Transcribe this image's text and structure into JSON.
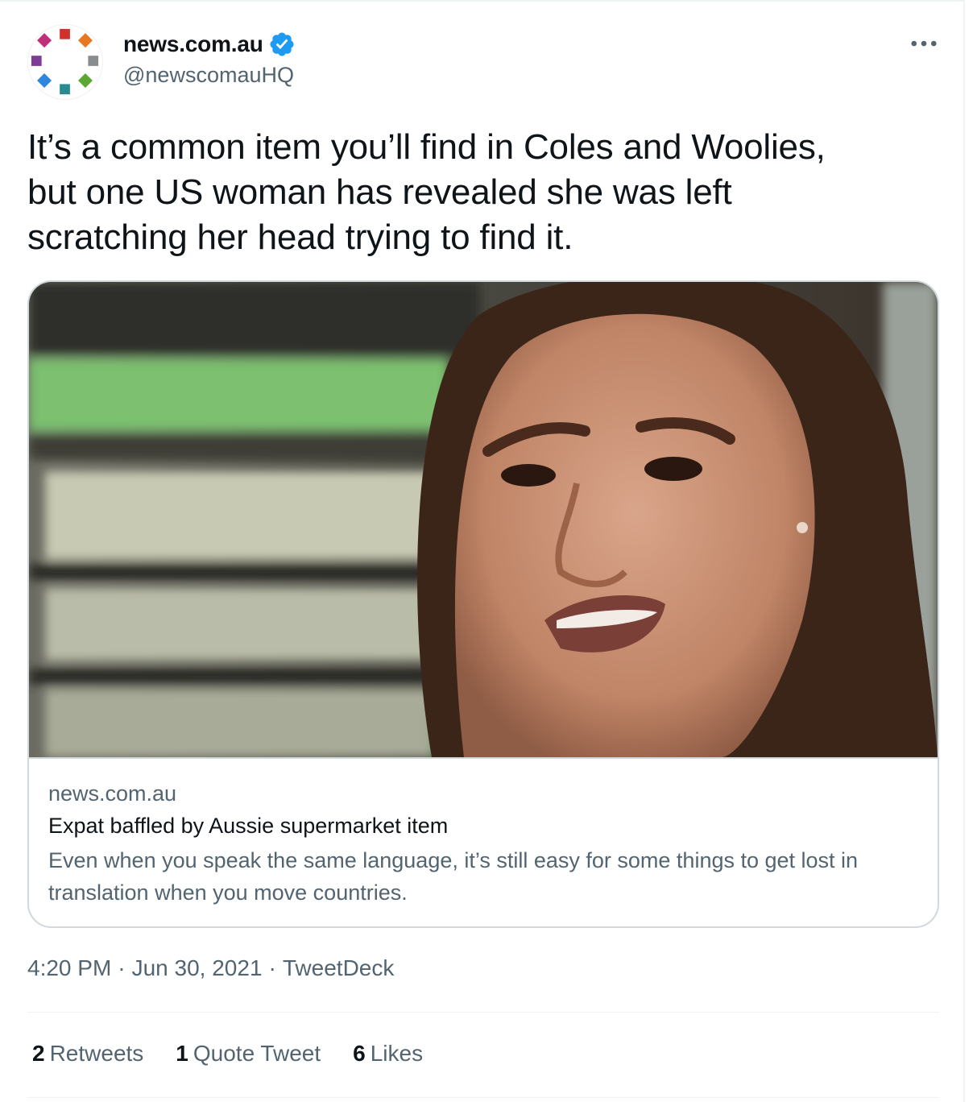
{
  "account": {
    "display_name": "news.com.au",
    "handle": "@newscomauHQ",
    "verified": true
  },
  "tweet": {
    "text": "It’s a common item you’ll find in Coles and Woolies,\nbut one US woman has revealed she was left\nscratching her head trying to find it."
  },
  "card": {
    "domain": "news.com.au",
    "title": "Expat baffled by Aussie supermarket item",
    "description": "Even when you speak the same language, it’s still easy for some things to get lost in translation when you move countries."
  },
  "meta": {
    "time": "4:20 PM",
    "separator": "·",
    "date": "Jun 30, 2021",
    "source": "TweetDeck"
  },
  "stats": {
    "retweets_count": "2",
    "retweets_label": "Retweets",
    "quotes_count": "1",
    "quotes_label": "Quote Tweet",
    "likes_count": "6",
    "likes_label": "Likes"
  },
  "icons": {
    "verified": "verified-badge-icon",
    "more": "more-horizontal-icon"
  },
  "colors": {
    "verified_blue": "#1d9bf0",
    "secondary_text": "#536471",
    "primary_text": "#0f1419",
    "border": "#cfd9de"
  }
}
